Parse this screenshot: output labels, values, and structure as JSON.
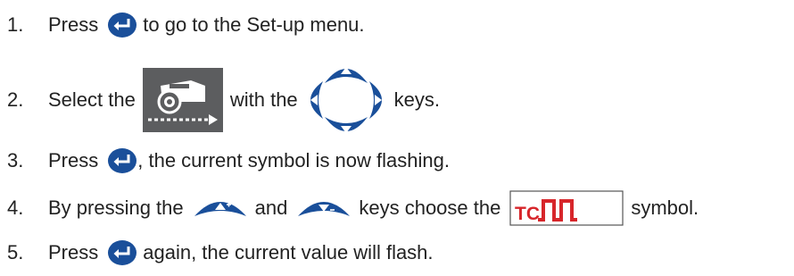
{
  "steps": [
    {
      "number": "1.",
      "text_a": "Press",
      "text_b": "to go to the Set-up menu.",
      "icons": [
        "enter-key-icon"
      ]
    },
    {
      "number": "2.",
      "text_a": "Select the",
      "text_b": "with the",
      "text_c": "keys.",
      "icons": [
        "baler-wrapper-icon",
        "arrow-keypad-icon"
      ]
    },
    {
      "number": "3.",
      "text_a": "Press",
      "text_b": ", the current symbol is now flashing.",
      "icons": [
        "enter-key-icon"
      ]
    },
    {
      "number": "4.",
      "text_a": "By pressing the",
      "text_b": "and",
      "text_c": "keys choose the",
      "text_d": "symbol.",
      "icons": [
        "up-plus-key-icon",
        "down-minus-key-icon",
        "tc-pulse-symbol-icon"
      ]
    },
    {
      "number": "5.",
      "text_a": "Press",
      "text_b": "again, the current value will flash.",
      "icons": [
        "enter-key-icon"
      ]
    }
  ],
  "symbol_label": "TC",
  "colors": {
    "key_blue": "#1a4f9a",
    "symbol_red": "#d7262b",
    "panel_gray": "#5c5d5f",
    "text": "#222222"
  }
}
